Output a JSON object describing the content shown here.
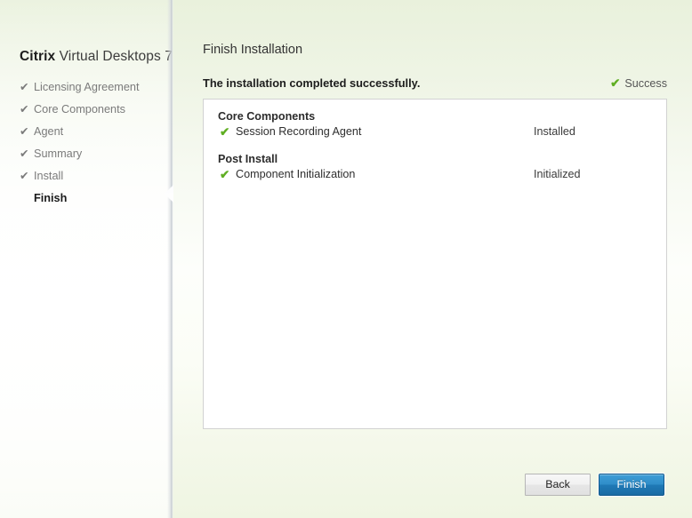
{
  "brand": {
    "strong": "Citrix",
    "rest": " Virtual Desktops 7"
  },
  "sidebar": {
    "steps": [
      {
        "label": "Licensing Agreement",
        "check": "✔",
        "state": "done"
      },
      {
        "label": "Core Components",
        "check": "✔",
        "state": "done"
      },
      {
        "label": "Agent",
        "check": "✔",
        "state": "done"
      },
      {
        "label": "Summary",
        "check": "✔",
        "state": "done"
      },
      {
        "label": "Install",
        "check": "✔",
        "state": "done"
      },
      {
        "label": "Finish",
        "check": "",
        "state": "current"
      }
    ]
  },
  "main": {
    "page_title": "Finish Installation",
    "result_text": "The installation completed successfully.",
    "result_status": "Success",
    "result_check": "✔",
    "groups": [
      {
        "title": "Core Components",
        "rows": [
          {
            "check": "✔",
            "label": "Session Recording Agent",
            "status": "Installed"
          }
        ]
      },
      {
        "title": "Post Install",
        "rows": [
          {
            "check": "✔",
            "label": "Component Initialization",
            "status": "Initialized"
          }
        ]
      }
    ]
  },
  "footer": {
    "back_label": "Back",
    "finish_label": "Finish"
  },
  "colors": {
    "success_green": "#5fae22",
    "primary_blue": "#1f79b6",
    "page_bg_green": "#e9f1dc",
    "panel_bg": "#ffffff",
    "panel_border": "#d2d2d2"
  }
}
